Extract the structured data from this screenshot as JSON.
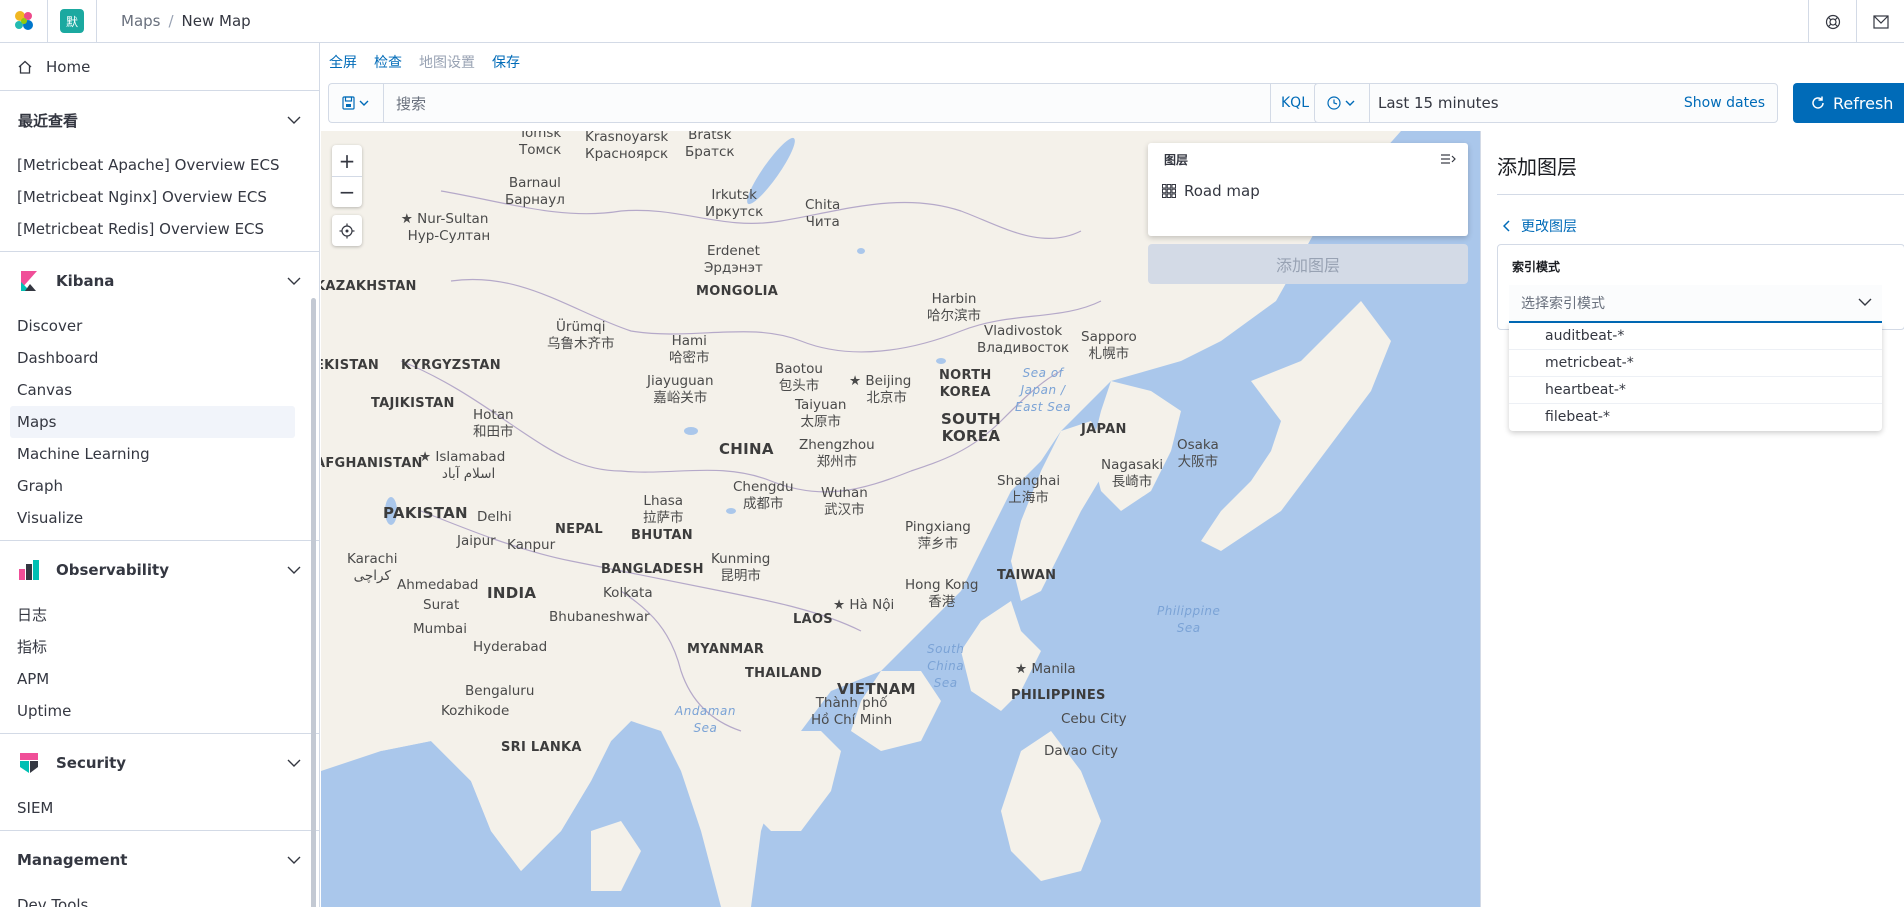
{
  "header": {
    "space_initial": "默",
    "breadcrumbs": [
      "Maps",
      "New Map"
    ]
  },
  "sidenav": {
    "home": "Home",
    "recent_title": "最近查看",
    "recent_items": [
      "[Metricbeat Apache] Overview ECS",
      "[Metricbeat Nginx] Overview ECS",
      "[Metricbeat Redis] Overview ECS"
    ],
    "groups": [
      {
        "title": "Kibana",
        "items": [
          "Discover",
          "Dashboard",
          "Canvas",
          "Maps",
          "Machine Learning",
          "Graph",
          "Visualize"
        ],
        "active": "Maps"
      },
      {
        "title": "Observability",
        "items": [
          "日志",
          "指标",
          "APM",
          "Uptime"
        ]
      },
      {
        "title": "Security",
        "items": [
          "SIEM"
        ]
      },
      {
        "title": "Management",
        "items": [
          "Dev Tools"
        ]
      }
    ]
  },
  "topmenu": {
    "fullscreen": "全屏",
    "inspect": "检查",
    "map_settings": "地图设置",
    "save": "保存"
  },
  "query": {
    "placeholder": "搜索",
    "language": "KQL"
  },
  "time": {
    "range": "Last 15 minutes",
    "show_dates": "Show dates",
    "refresh": "Refresh"
  },
  "layers": {
    "title": "图层",
    "items": [
      "Road map"
    ],
    "add_button": "添加图层"
  },
  "flyout": {
    "title": "添加图层",
    "back": "更改图层",
    "index_label": "索引模式",
    "index_placeholder": "选择索引模式",
    "options": [
      "auditbeat-*",
      "metricbeat-*",
      "heartbeat-*",
      "filebeat-*"
    ]
  },
  "map_labels": {
    "tomsk": "Tomsk\nТомск",
    "krasnoyarsk": "Krasnoyarsk\nКрасноярск",
    "bratsk": "Bratsk\nБратск",
    "barnaul": "Barnaul\nБарнаул",
    "irkutsk": "Irkutsk\nИркутск",
    "chita": "Chita\nЧита",
    "nursultan": "Nur-Sultan\nНур-Султан",
    "erdenet": "Erdenet\nЭрдэнэт",
    "kazakhstan": "KAZAKHSTAN",
    "mongolia": "MONGOLIA",
    "harbin": "Harbin\n哈尔滨市",
    "urumqi": "Ürümqi\n乌鲁木齐市",
    "hami": "Hami\n哈密市",
    "vladivostok": "Vladivostok\nВладивосток",
    "sapporo": "Sapporo\n札幌市",
    "uzbekistan": "EKISTAN",
    "kyrgyzstan": "KYRGYZSTAN",
    "jiayuguan": "Jiayuguan\n嘉峪关市",
    "baotou": "Baotou\n包头市",
    "beijing": "Beijing\n北京市",
    "northkorea": "NORTH\nKOREA",
    "seajapan": "Sea of\nJapan /\nEast Sea",
    "tajikistan": "TAJIKISTAN",
    "hotan": "Hotan\n和田市",
    "taiyuan": "Taiyuan\n太原市",
    "southkorea": "SOUTH\nKOREA",
    "japan": "JAPAN",
    "afghanistan": "AFGHANISTAN",
    "islamabad": "Islamabad\nاسلام آباد",
    "china": "CHINA",
    "zhengzhou": "Zhengzhou\n郑州市",
    "osaka": "Osaka\n大阪市",
    "nagasaki": "Nagasaki\n長崎市",
    "pakistan": "PAKISTAN",
    "lhasa": "Lhasa\n拉萨市",
    "chengdu": "Chengdu\n成都市",
    "wuhan": "Wuhan\n武汉市",
    "shanghai": "Shanghai\n上海市",
    "delhi": "Delhi",
    "nepal": "NEPAL",
    "bhutan": "BHUTAN",
    "pingxiang": "Pingxiang\n萍乡市",
    "jaipur": "Jaipur",
    "kanpur": "Kanpur",
    "karachi": "Karachi\nکراچی",
    "kunming": "Kunming\n昆明市",
    "bangladesh": "BANGLADESH",
    "taiwan": "TAIWAN",
    "ahmedabad": "Ahmedabad",
    "india": "INDIA",
    "kolkata": "Kolkata",
    "hongkong": "Hong Kong\n香港",
    "surat": "Surat",
    "hanoi": "Hà Nội",
    "laos": "LAOS",
    "philsea": "Philippine\nSea",
    "bhubaneshwar": "Bhubaneshwar",
    "mumbai": "Mumbai",
    "myanmar": "MYANMAR",
    "hyderabad": "Hyderabad",
    "scs": "South\nChina\nSea",
    "thailand": "THAILAND",
    "manila": "Manila",
    "vietnam": "VIETNAM",
    "philippines": "PHILIPPINES",
    "bengaluru": "Bengaluru",
    "kozhikode": "Kozhikode",
    "andaman": "Andaman\nSea",
    "hcm": "Thành phố\nHồ Chí Minh",
    "cebu": "Cebu City",
    "srilanka": "SRI LANKA",
    "davao": "Davao City"
  }
}
